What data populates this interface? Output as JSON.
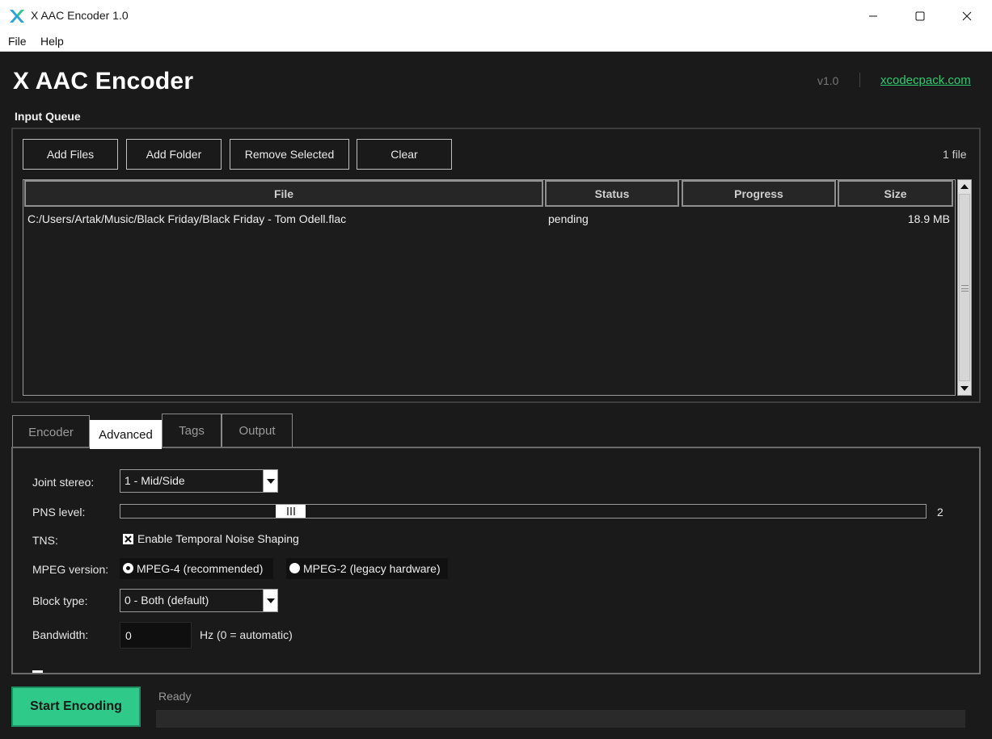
{
  "window": {
    "title": "X AAC Encoder 1.0"
  },
  "menu": {
    "file": "File",
    "help": "Help"
  },
  "header": {
    "title": "X AAC Encoder",
    "version": "v1.0",
    "link": "xcodecpack.com"
  },
  "queue": {
    "section_label": "Input Queue",
    "buttons": {
      "add_files": "Add Files",
      "add_folder": "Add Folder",
      "remove_selected": "Remove Selected",
      "clear": "Clear"
    },
    "file_count": "1 file",
    "columns": {
      "file": "File",
      "status": "Status",
      "progress": "Progress",
      "size": "Size"
    },
    "rows": [
      {
        "file": "C:/Users/Artak/Music/Black Friday/Black Friday - Tom Odell.flac",
        "status": "pending",
        "progress": "",
        "size": "18.9 MB"
      }
    ]
  },
  "tabs": {
    "encoder": "Encoder",
    "advanced": "Advanced",
    "tags": "Tags",
    "output": "Output",
    "active": "advanced"
  },
  "advanced": {
    "joint_stereo_label": "Joint stereo:",
    "joint_stereo_value": "1 - Mid/Side",
    "pns_label": "PNS level:",
    "pns_value": "2",
    "pns_fraction": 0.2,
    "tns_label": "TNS:",
    "tns_checkbox_label": "Enable Temporal Noise Shaping",
    "tns_checked": true,
    "mpeg_label": "MPEG version:",
    "mpeg4_label": "MPEG-4 (recommended)",
    "mpeg2_label": "MPEG-2 (legacy hardware)",
    "mpeg_selected": "mpeg4",
    "block_label": "Block type:",
    "block_value": "0 - Both (default)",
    "bandwidth_label": "Bandwidth:",
    "bandwidth_value": "0",
    "bandwidth_unit": "Hz (0 = automatic)"
  },
  "footer": {
    "start_button": "Start Encoding",
    "status": "Ready",
    "progress_fraction": 0
  },
  "colors": {
    "accent": "#2fc98a",
    "link": "#2ecc71",
    "background": "#1a1a1a"
  }
}
